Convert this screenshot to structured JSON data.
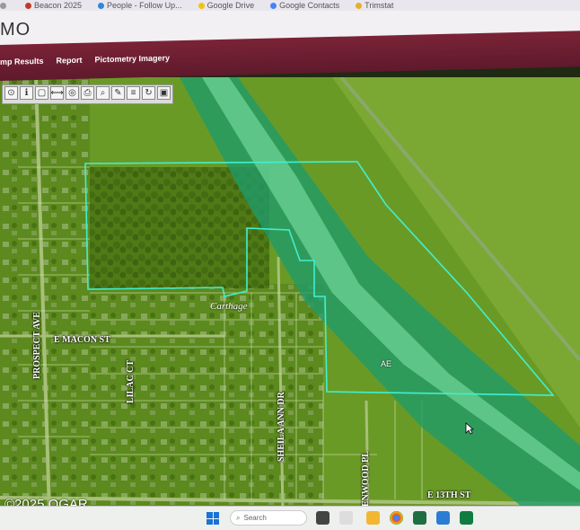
{
  "bookmarks": [
    {
      "label": "",
      "icon": "bookmark-icon"
    },
    {
      "label": "Beacon 2025",
      "icon": "beacon-icon"
    },
    {
      "label": "People - Follow Up...",
      "icon": "people-icon"
    },
    {
      "label": "Google Drive",
      "icon": "google-drive-icon"
    },
    {
      "label": "Google Contacts",
      "icon": "google-contacts-icon"
    },
    {
      "label": "Trimstat",
      "icon": "bookmark-icon"
    }
  ],
  "app": {
    "title": "MO"
  },
  "nav": {
    "items": [
      "mp Results",
      "Report",
      "Pictometry Imagery"
    ]
  },
  "toolbar": {
    "tools": [
      "identify-tool-icon",
      "info-tool-icon",
      "select-tool-icon",
      "measure-tool-icon",
      "buffer-tool-icon",
      "print-tool-icon",
      "search-tool-icon",
      "draw-tool-icon",
      "layers-tool-icon",
      "refresh-tool-icon",
      "save-tool-icon"
    ]
  },
  "map": {
    "streets": {
      "e_macon": "E MACON ST",
      "prospect": "PROSPECT AVE",
      "lilac": "LILAC CT",
      "sheila_ann": "SHEILA ANN DR",
      "enwood": "ENWOOD PL",
      "e13": "E 13TH ST"
    },
    "place_label": "Carthage",
    "zone_label": "AE",
    "copyright": "©2025 OGAR",
    "colors": {
      "parcel_outline": "#3ff0d0",
      "floodway": "#1f9b6a",
      "flood_zone": "#4dc28a"
    }
  },
  "taskbar": {
    "search_placeholder": "Search"
  }
}
